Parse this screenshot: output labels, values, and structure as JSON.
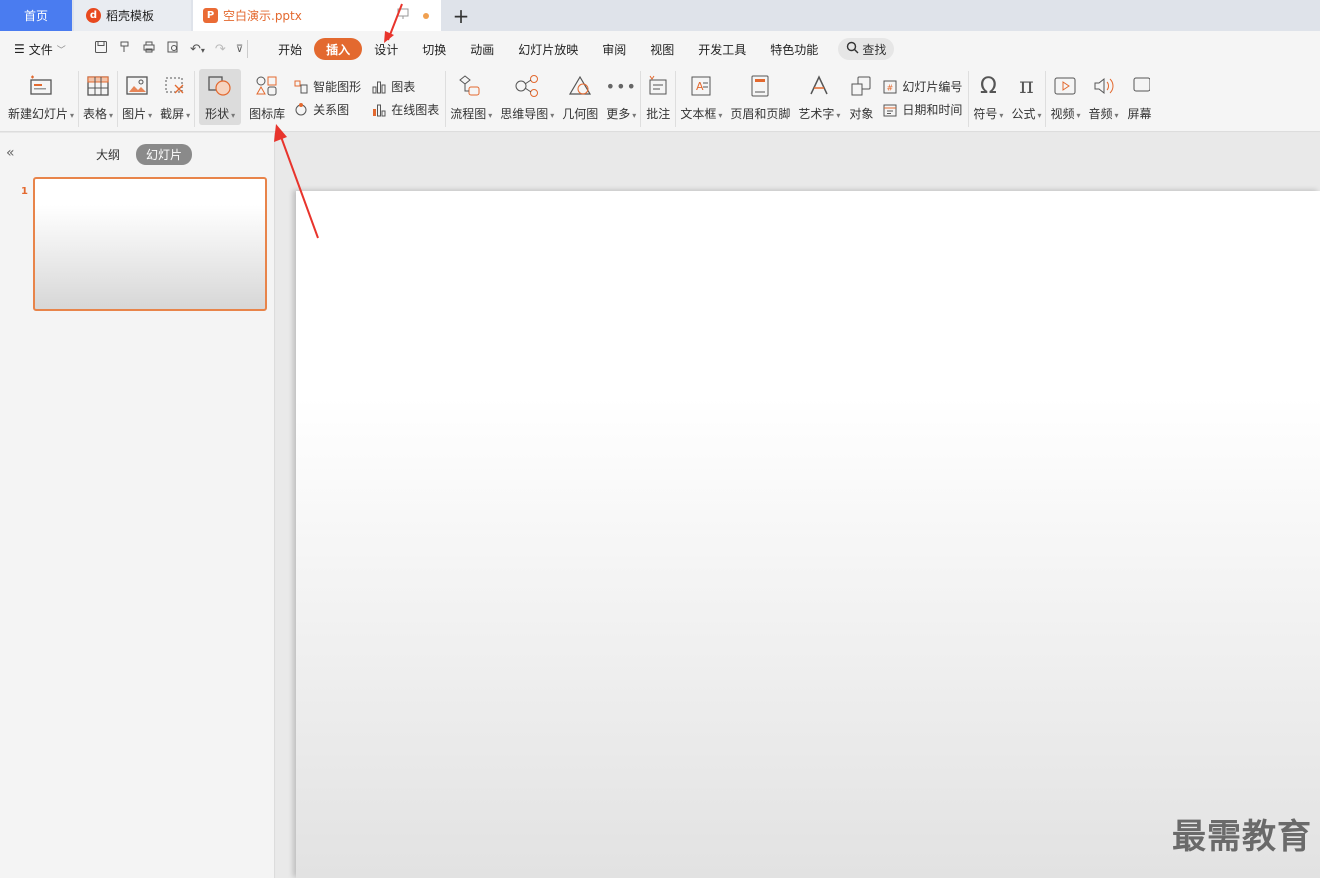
{
  "tabs": {
    "home": "首页",
    "template": "稻壳模板",
    "document": "空白演示.pptx"
  },
  "menu": {
    "file": "文件",
    "tabs": [
      "开始",
      "插入",
      "设计",
      "切换",
      "动画",
      "幻灯片放映",
      "审阅",
      "视图",
      "开发工具",
      "特色功能"
    ],
    "active_tab": "插入",
    "search": "查找"
  },
  "ribbon": {
    "new_slide": "新建幻灯片",
    "table": "表格",
    "picture": "图片",
    "screenshot": "截屏",
    "shape": "形状",
    "icon_library": "图标库",
    "smart_art": "智能图形",
    "chart": "图表",
    "relation": "关系图",
    "online_chart": "在线图表",
    "flowchart": "流程图",
    "mindmap": "思维导图",
    "geometry": "几何图",
    "more": "更多",
    "comment": "批注",
    "textbox": "文本框",
    "header_footer": "页眉和页脚",
    "wordart": "艺术字",
    "object": "对象",
    "slide_number": "幻灯片编号",
    "date_time": "日期和时间",
    "symbol": "符号",
    "formula": "公式",
    "video": "视频",
    "audio": "音频",
    "screen": "屏幕"
  },
  "left_panel": {
    "outline": "大纲",
    "slides": "幻灯片",
    "slide_index": "1"
  },
  "watermark": "最需教育",
  "colors": {
    "accent": "#e3692f",
    "home_tab": "#4a7cf0",
    "arrow": "#e8342c"
  }
}
